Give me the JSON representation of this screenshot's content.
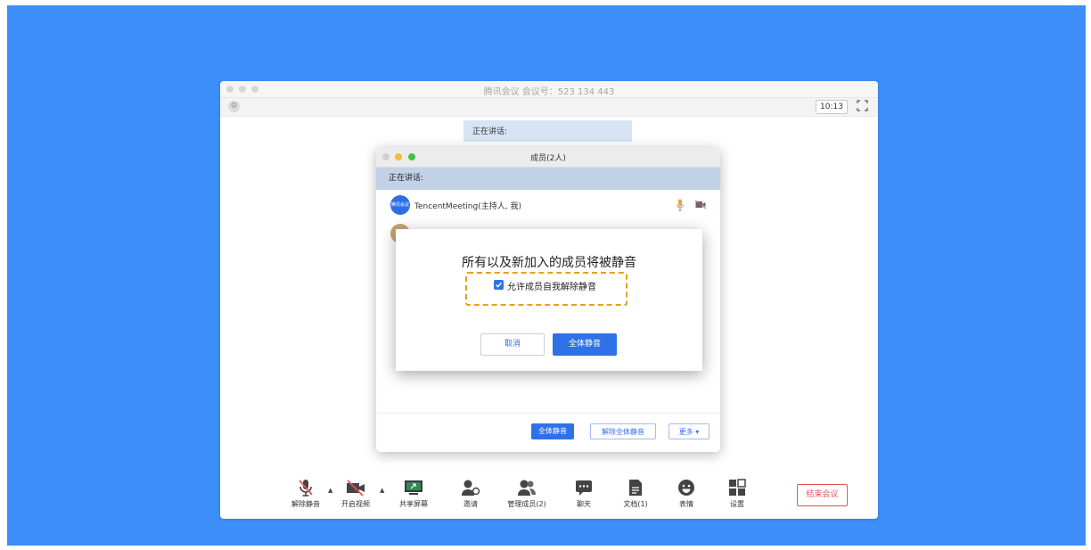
{
  "window": {
    "title": "腾讯会议 会议号：523 134 443",
    "time": "10:13"
  },
  "meeting": {
    "speaking_label": "正在讲话:"
  },
  "members_panel": {
    "title": "成员(2人)",
    "speaking_label": "正在讲话:",
    "members": [
      {
        "name": "TencentMeeting(主持人, 我)",
        "avatar_text": "腾讯会议"
      }
    ],
    "buttons": {
      "mute_all": "全体静音",
      "unmute_all": "解除全体静音",
      "more": "更多 ▾"
    }
  },
  "confirm_dialog": {
    "title": "所有以及新加入的成员将被静音",
    "checkbox_label": "允许成员自我解除静音",
    "checkbox_checked": true,
    "cancel": "取消",
    "confirm": "全体静音"
  },
  "toolbar": {
    "unmute": "解除静音",
    "start_video": "开启视频",
    "share_screen": "共享屏幕",
    "invite": "邀请",
    "manage_members": "管理成员(2)",
    "chat": "聊天",
    "docs": "文档(1)",
    "emoji": "表情",
    "settings": "设置",
    "end_meeting": "结束会议"
  },
  "colors": {
    "background": "#3d8ef8",
    "accent": "#2f72e8",
    "danger": "#e25555",
    "highlight": "#e1a21b"
  }
}
